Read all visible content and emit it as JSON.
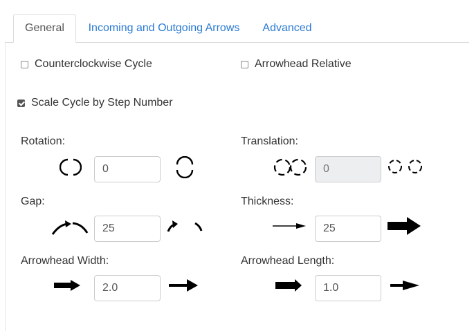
{
  "tabs": [
    {
      "label": "General",
      "active": true
    },
    {
      "label": "Incoming and Outgoing Arrows",
      "active": false
    },
    {
      "label": "Advanced",
      "active": false
    }
  ],
  "checkboxes": {
    "counterclockwise_cycle": {
      "label": "Counterclockwise Cycle",
      "checked": false
    },
    "arrowhead_relative": {
      "label": "Arrowhead Relative",
      "checked": false
    },
    "scale_cycle": {
      "label": "Scale Cycle by Step Number",
      "checked": true
    }
  },
  "fields": {
    "rotation": {
      "label": "Rotation:",
      "value": "0"
    },
    "translation": {
      "label": "Translation:",
      "value": "0",
      "disabled": true
    },
    "gap": {
      "label": "Gap:",
      "value": "25"
    },
    "thickness": {
      "label": "Thickness:",
      "value": "25"
    },
    "arrowhead_width": {
      "label": "Arrowhead Width:",
      "value": "2.0"
    },
    "arrowhead_length": {
      "label": "Arrowhead Length:",
      "value": "1.0"
    }
  },
  "colors": {
    "link": "#2a7ad4",
    "text": "#333333",
    "disabled_bg": "#eceeef"
  }
}
